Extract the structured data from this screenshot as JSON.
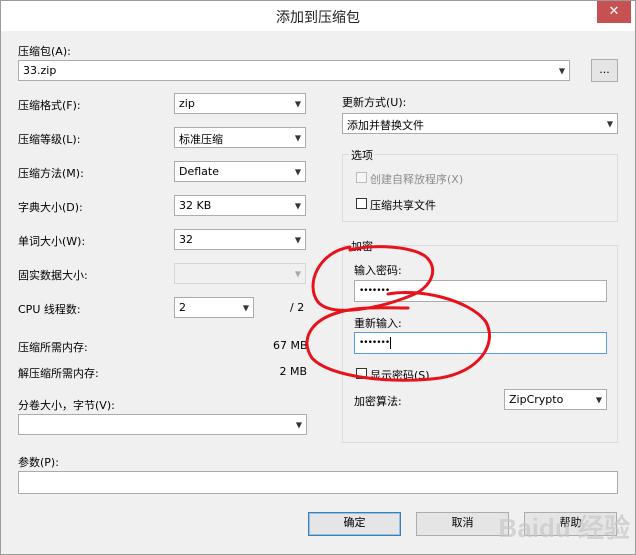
{
  "window": {
    "title": "添加到压缩包",
    "close_glyph": "✕"
  },
  "archive": {
    "label": "压缩包(A):",
    "value": "33.zip",
    "browse_label": "..."
  },
  "format": {
    "label": "压缩格式(F):",
    "value": "zip"
  },
  "level": {
    "label": "压缩等级(L):",
    "value": "标准压缩"
  },
  "method": {
    "label": "压缩方法(M):",
    "value": "Deflate"
  },
  "dict": {
    "label": "字典大小(D):",
    "value": "32 KB"
  },
  "word": {
    "label": "单词大小(W):",
    "value": "32"
  },
  "solid": {
    "label": "固实数据大小:",
    "value": ""
  },
  "cpu": {
    "label": "CPU 线程数:",
    "value": "2",
    "total": "/ 2"
  },
  "mem_compress": {
    "label": "压缩所需内存:",
    "value": "67 MB"
  },
  "mem_decompress": {
    "label": "解压缩所需内存:",
    "value": "2 MB"
  },
  "split": {
    "label": "分卷大小，字节(V):",
    "value": ""
  },
  "params": {
    "label": "参数(P):",
    "value": ""
  },
  "update": {
    "label": "更新方式(U):",
    "value": "添加并替换文件"
  },
  "options": {
    "title": "选项",
    "sfx_label": "创建自释放程序(X)",
    "shared_label": "压缩共享文件"
  },
  "encryption": {
    "title": "加密",
    "password_label": "输入密码:",
    "password_value": "•••••••",
    "reenter_label": "重新输入:",
    "reenter_value": "•••••••",
    "show_password_label": "显示密码(S)",
    "method_label": "加密算法:",
    "method_value": "ZipCrypto"
  },
  "buttons": {
    "ok": "确定",
    "cancel": "取消",
    "help": "帮助"
  },
  "watermark": "Baidu 经验",
  "colors": {
    "annotation": "#e8121a",
    "focus_border": "#569de5",
    "close_bg": "#c75050"
  }
}
